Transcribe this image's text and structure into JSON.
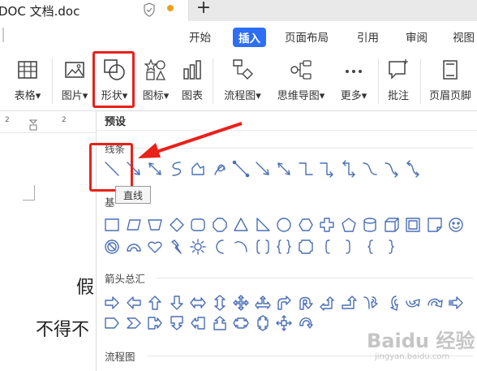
{
  "titlebar": {
    "doc_title": "DOC 文档.doc",
    "new_tab": "+"
  },
  "ribbon_tabs": [
    "开始",
    "插入",
    "页面布局",
    "引用",
    "审阅",
    "视图"
  ],
  "active_tab": "插入",
  "ribbon_buttons": [
    {
      "label": "表格",
      "icon": "table-icon",
      "dropdown": true
    },
    {
      "label": "图片",
      "icon": "picture-icon",
      "dropdown": true
    },
    {
      "label": "形状",
      "icon": "shapes-icon",
      "dropdown": true
    },
    {
      "label": "图标",
      "icon": "icons-icon",
      "dropdown": true
    },
    {
      "label": "图表",
      "icon": "chart-icon",
      "dropdown": false
    },
    {
      "label": "流程图",
      "icon": "flowchart-icon",
      "dropdown": true
    },
    {
      "label": "思维导图",
      "icon": "mindmap-icon",
      "dropdown": true
    },
    {
      "label": "更多",
      "icon": "more-icon",
      "dropdown": true
    },
    {
      "label": "批注",
      "icon": "comment-icon",
      "dropdown": false
    },
    {
      "label": "页眉页脚",
      "icon": "header-footer-icon",
      "dropdown": false
    }
  ],
  "ruler": {
    "numbers": [
      "2",
      "2"
    ]
  },
  "document": {
    "line1": "假",
    "line2": "不得不"
  },
  "panel": {
    "header": "预设",
    "sections": {
      "lines": "线条",
      "basic": "基",
      "arrows": "箭头总汇",
      "flowchart": "流程图"
    },
    "tooltip": "直线"
  },
  "watermark": {
    "text": "Baidu 经验",
    "sub": "jingyan.baidu.com"
  },
  "colors": {
    "accent": "#2e6ef5",
    "annotation_red": "#e8211a",
    "shape_blue": "#4a6fb5"
  }
}
